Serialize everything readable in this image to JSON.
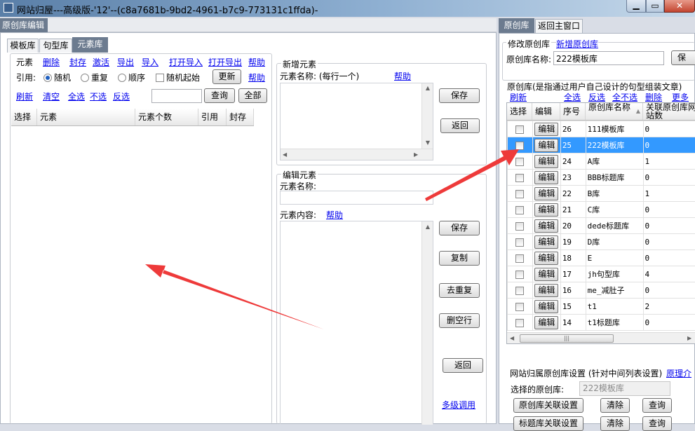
{
  "window": {
    "title": "网站归屋---高级版-'12'--(c8a7681b-9bd2-4961-b7c9-773131c1ffda)-"
  },
  "left": {
    "tab_header": "原创库编辑",
    "tabs": [
      "模板库",
      "句型库",
      "元素库"
    ],
    "element_label": "元素",
    "element_links": [
      "删除",
      "封存",
      "激活",
      "导出",
      "导入",
      "打开导入",
      "打开导出",
      "帮助"
    ],
    "ref_label": "引用:",
    "ref_options": {
      "random": "随机",
      "repeat": "重复",
      "sequence": "顺序",
      "random_start": "随机起始"
    },
    "update_button": "更新",
    "help": "帮助",
    "filter_links": [
      "刷新",
      "清空",
      "全选",
      "不选",
      "反选"
    ],
    "query_button": "查询",
    "all_button": "全部",
    "search_value": "",
    "grid_headers": [
      "选择",
      "元素",
      "元素个数",
      "引用",
      "封存"
    ]
  },
  "middle": {
    "new_element": {
      "group_title": "新增元素",
      "name_label": "元素名称: (每行一个)",
      "help": "帮助",
      "save": "保存",
      "back": "返回"
    },
    "edit_element": {
      "group_title": "编辑元素",
      "name_label": "元素名称:",
      "content_label": "元素内容:",
      "help": "帮助",
      "save": "保存",
      "copy": "复制",
      "dedupe": "去重复",
      "delete_empty": "删空行",
      "back": "返回",
      "multilevel": "多级调用"
    }
  },
  "right": {
    "tabs": [
      "原创库",
      "返回主窗口"
    ],
    "modify_label": "修改原创库",
    "new_link": "新增原创库",
    "name_label": "原创库名称:",
    "name_value": "222模板库",
    "save_button": "保",
    "desc": "原创库(是指通过用户自己设计的句型组装文章)",
    "links": [
      "刷新",
      "全选",
      "反选",
      "全不选",
      "删除",
      "更多"
    ],
    "grid_headers": [
      "选择",
      "编辑",
      "序号",
      "原创库名称",
      "关联原创库网站数"
    ],
    "edit_label": "编辑",
    "rows": [
      {
        "no": "26",
        "name": "111模板库",
        "count": "0"
      },
      {
        "no": "25",
        "name": "222模板库",
        "count": "0"
      },
      {
        "no": "24",
        "name": "A库",
        "count": "1"
      },
      {
        "no": "23",
        "name": "BBB标题库",
        "count": "0"
      },
      {
        "no": "22",
        "name": "B库",
        "count": "1"
      },
      {
        "no": "21",
        "name": "C库",
        "count": "0"
      },
      {
        "no": "20",
        "name": "dede标题库",
        "count": "0"
      },
      {
        "no": "19",
        "name": "D库",
        "count": "0"
      },
      {
        "no": "18",
        "name": "E",
        "count": "0"
      },
      {
        "no": "17",
        "name": "jh句型库",
        "count": "4"
      },
      {
        "no": "16",
        "name": "me_减肚子",
        "count": "0"
      },
      {
        "no": "15",
        "name": "t1",
        "count": "2"
      },
      {
        "no": "14",
        "name": "t1标题库",
        "count": "0"
      }
    ],
    "selected_row": 1,
    "settings_label": "网站归属原创库设置 (针对中间列表设置)",
    "principle_link": "原理介",
    "selected_label": "选择的原创库:",
    "selected_value": "222模板库",
    "assoc_button": "原创库关联设置",
    "clear_button": "清除",
    "query_button": "查询",
    "title_assoc_button": "标题库关联设置",
    "clear_button2": "清除",
    "query_button2": "查询"
  },
  "colors": {
    "selected_row": "#3399ff",
    "arrow": "#ee3a3a",
    "link": "#0000ee"
  }
}
